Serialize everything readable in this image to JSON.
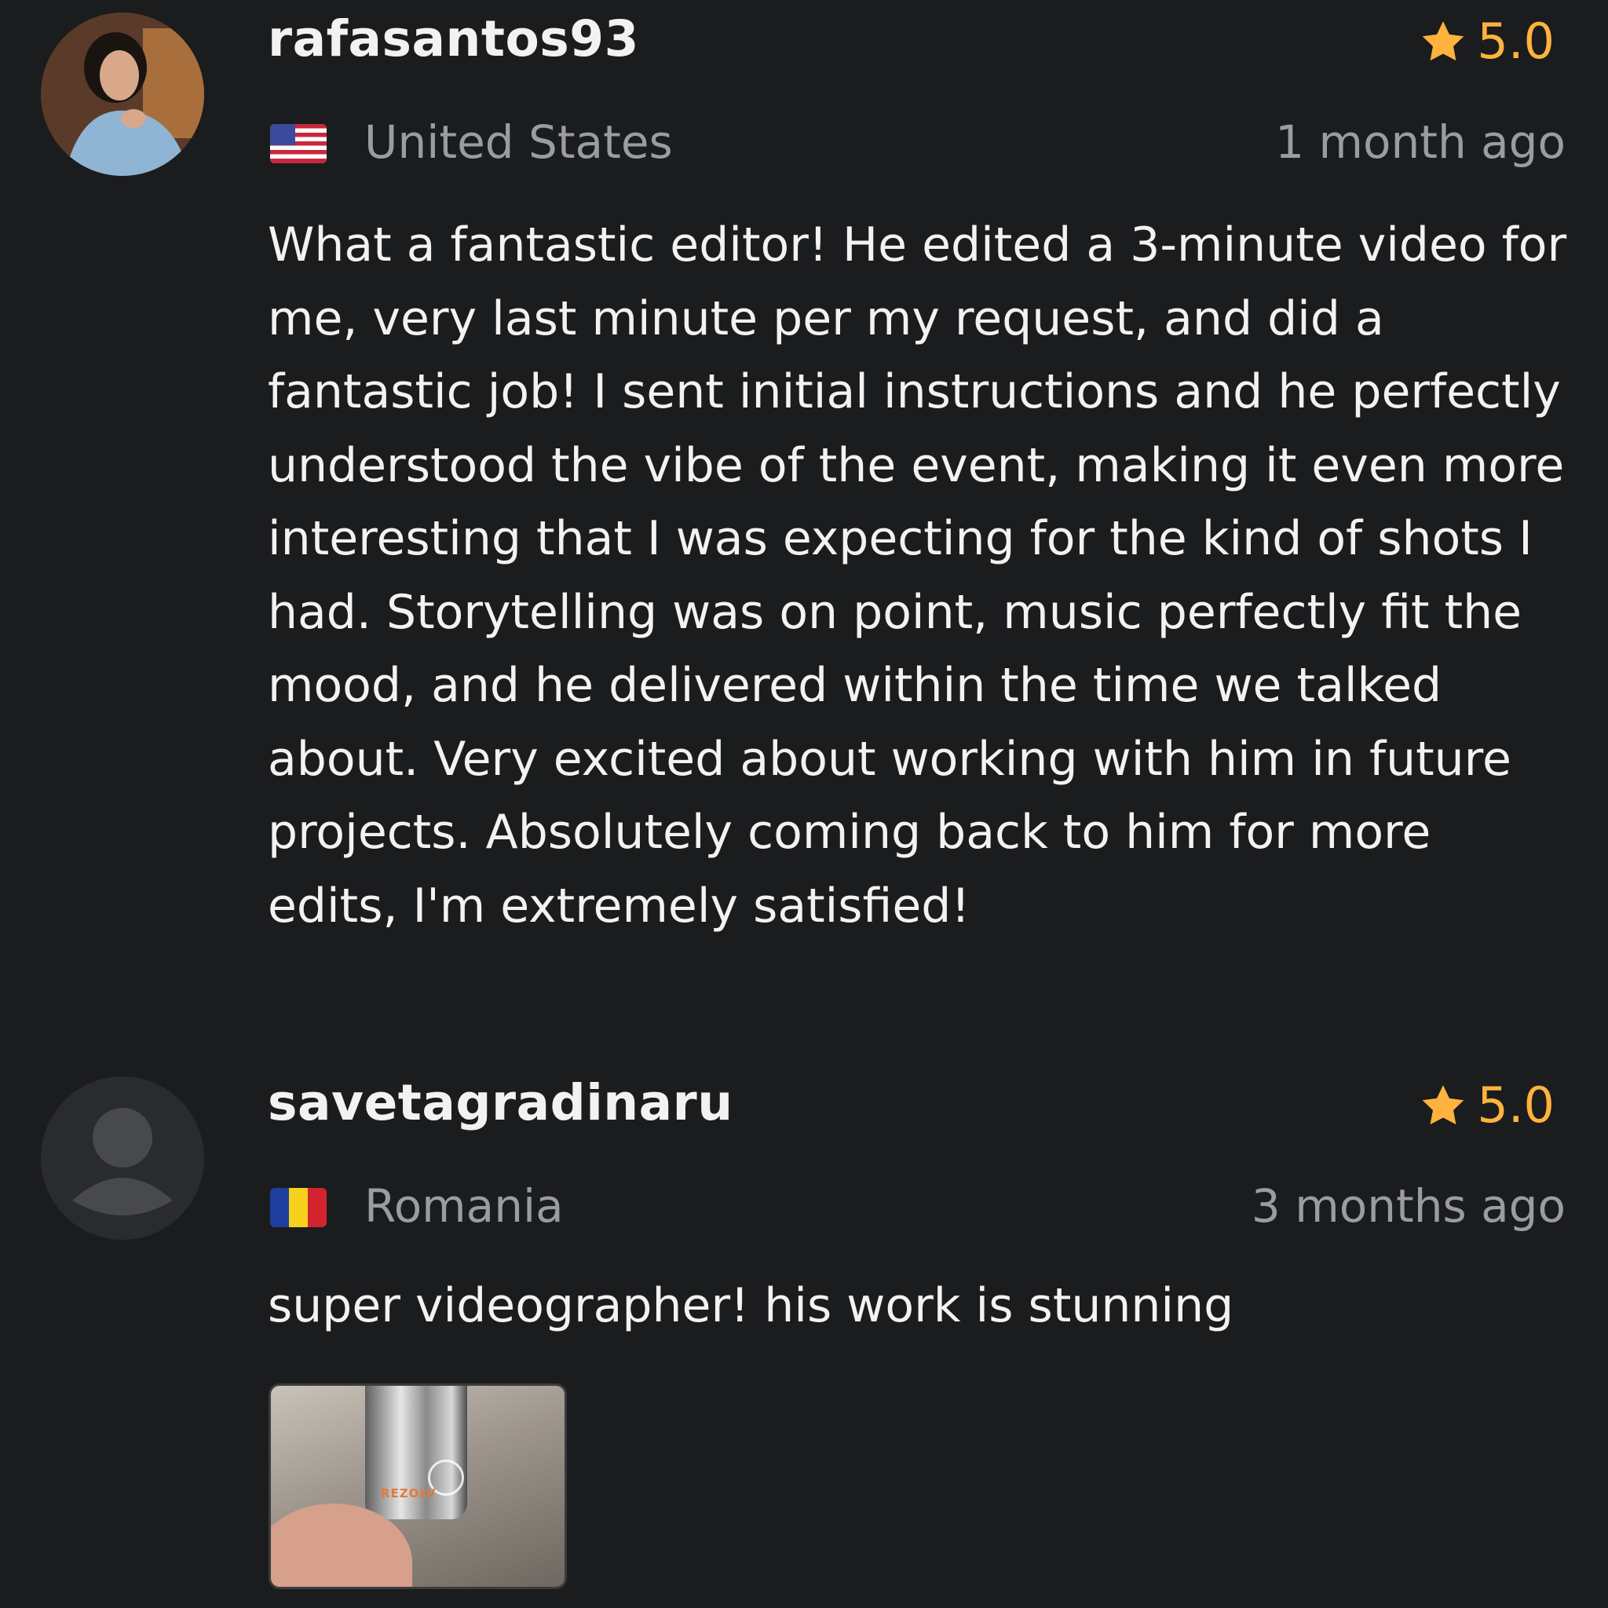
{
  "reviews": [
    {
      "username": "rafasantos93",
      "rating": "5.0",
      "country": "United States",
      "flag": "us-flag",
      "time_ago": "1 month ago",
      "text": "What a fantastic editor! He edited a 3-minute video for me, very last minute per my request, and did a fantastic job! I sent initial instructions and he perfectly understood the vibe of the event, making it even more interesting that I was expecting for the kind of shots I had. Storytelling was on point, music perfectly fit the mood, and he delivered within the time we talked about. Very excited about working with him in future projects. Absolutely coming back to him for more edits, I'm extremely satisfied!",
      "avatar": "user-photo"
    },
    {
      "username": "savetagradinaru",
      "rating": "5.0",
      "country": "Romania",
      "flag": "romania-flag",
      "time_ago": "3 months ago",
      "text": "super videographer! his work is stunning",
      "avatar": "default-user-icon",
      "attachment": {
        "watermark": "REZOLV"
      }
    }
  ],
  "colors": {
    "background": "#1b1c1e",
    "star": "#ffb33e",
    "muted_text": "#9a9ca0",
    "primary_text": "#f2f2f2"
  }
}
